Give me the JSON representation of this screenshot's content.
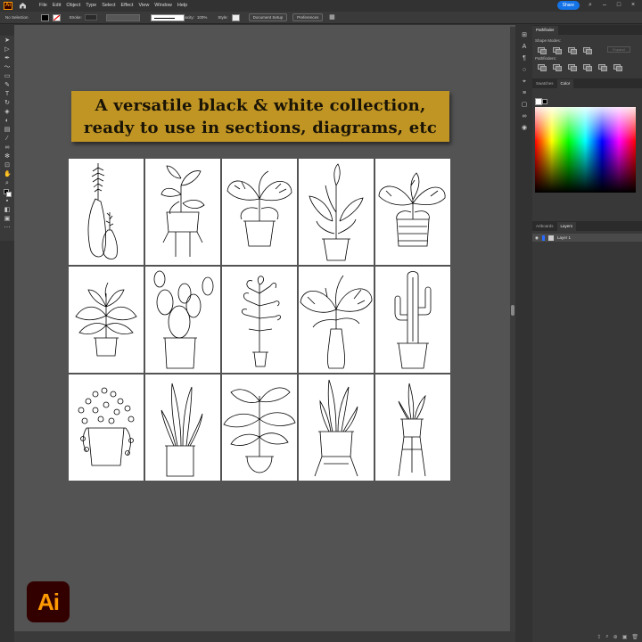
{
  "menubar": {
    "app_logo": "Ai",
    "items": [
      "File",
      "Edit",
      "Object",
      "Type",
      "Select",
      "Effect",
      "View",
      "Window",
      "Help"
    ],
    "share_label": "Share",
    "icons": [
      "home-icon",
      "search-icon",
      "minimize-icon",
      "maximize-icon",
      "close-icon"
    ]
  },
  "controlbar": {
    "selection": "No Selection",
    "stroke_label": "Stroke:",
    "stroke_style": "Basic",
    "opacity_label": "Opacity:",
    "opacity_value": "100%",
    "style_label": "Style:",
    "document_setup": "Document Setup",
    "preferences": "Preferences"
  },
  "canvas": {
    "banner_line1": "A versatile black & white collection,",
    "banner_line2": "ready to use in sections, diagrams, etc",
    "banner_color": "#c09524",
    "plants": [
      "vases-with-fern",
      "rubber-plant-on-stand",
      "monstera-pot",
      "bird-of-paradise",
      "monstera-basket",
      "leafy-bush",
      "prickly-pear-cactus",
      "tall-foliage-tree",
      "monstera-vase",
      "saguaro-cactus",
      "ivy-pot",
      "snake-plant",
      "large-leaf-plant",
      "snake-plant-on-stand",
      "snake-plant-tripod"
    ]
  },
  "panels": {
    "pathfinder_tab": "Pathfinder",
    "shape_modes_label": "Shape Modes:",
    "pathfinders_label": "Pathfinders:",
    "expand_label": "Expand",
    "swatches_tab": "Swatches",
    "color_tab": "Color",
    "artboards_tab": "Artboards",
    "layers_tab": "Layers",
    "layer_name": "Layer 1"
  },
  "ai_badge": "Ai"
}
